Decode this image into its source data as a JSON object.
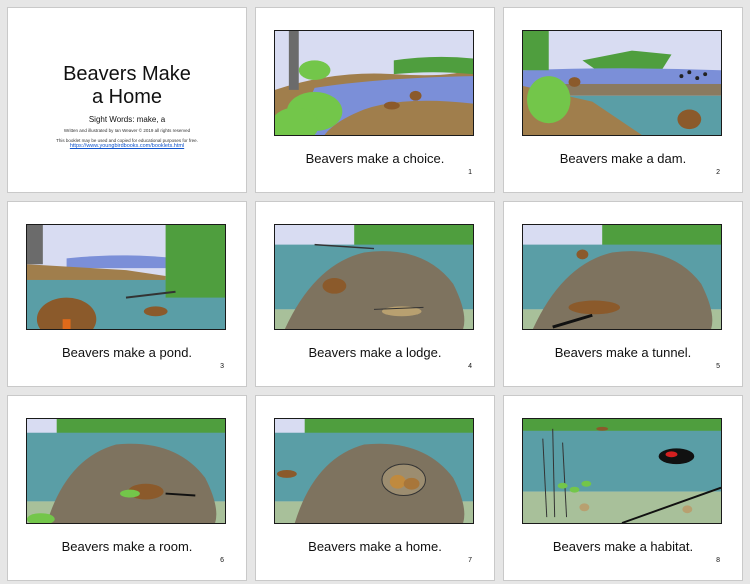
{
  "cover": {
    "title_line1": "Beavers Make",
    "title_line2": "a Home",
    "sight_words": "Sight Words: make, a",
    "credit_line1": "Written and illustrated by Ian Weaver © 2019 all rights reserved",
    "credit_line2": "This booklet may be used and copied for educational purposes for free.",
    "url": "https://www.youngbirdbooks.com/booklets.html"
  },
  "pages": [
    {
      "caption": "Beavers make a choice.",
      "number": "1",
      "scene": "choice"
    },
    {
      "caption": "Beavers make a dam.",
      "number": "2",
      "scene": "dam"
    },
    {
      "caption": "Beavers make a pond.",
      "number": "3",
      "scene": "pond"
    },
    {
      "caption": "Beavers make a lodge.",
      "number": "4",
      "scene": "lodge"
    },
    {
      "caption": "Beavers make a tunnel.",
      "number": "5",
      "scene": "tunnel"
    },
    {
      "caption": "Beavers make a room.",
      "number": "6",
      "scene": "room"
    },
    {
      "caption": "Beavers make a home.",
      "number": "7",
      "scene": "home"
    },
    {
      "caption": "Beavers make a habitat.",
      "number": "8",
      "scene": "habitat"
    }
  ],
  "colors": {
    "sky": "#d8dcf2",
    "water": "#5a9ea6",
    "river": "#7b8fd8",
    "mud": "#a07e4c",
    "lodge": "#7e735f",
    "bush": "#73c64a",
    "forest": "#4f9e3e",
    "trunk": "#6b6b6b",
    "beaver": "#8b5a2b",
    "underwater": "#a8c09a",
    "bird_red": "#d42020"
  }
}
